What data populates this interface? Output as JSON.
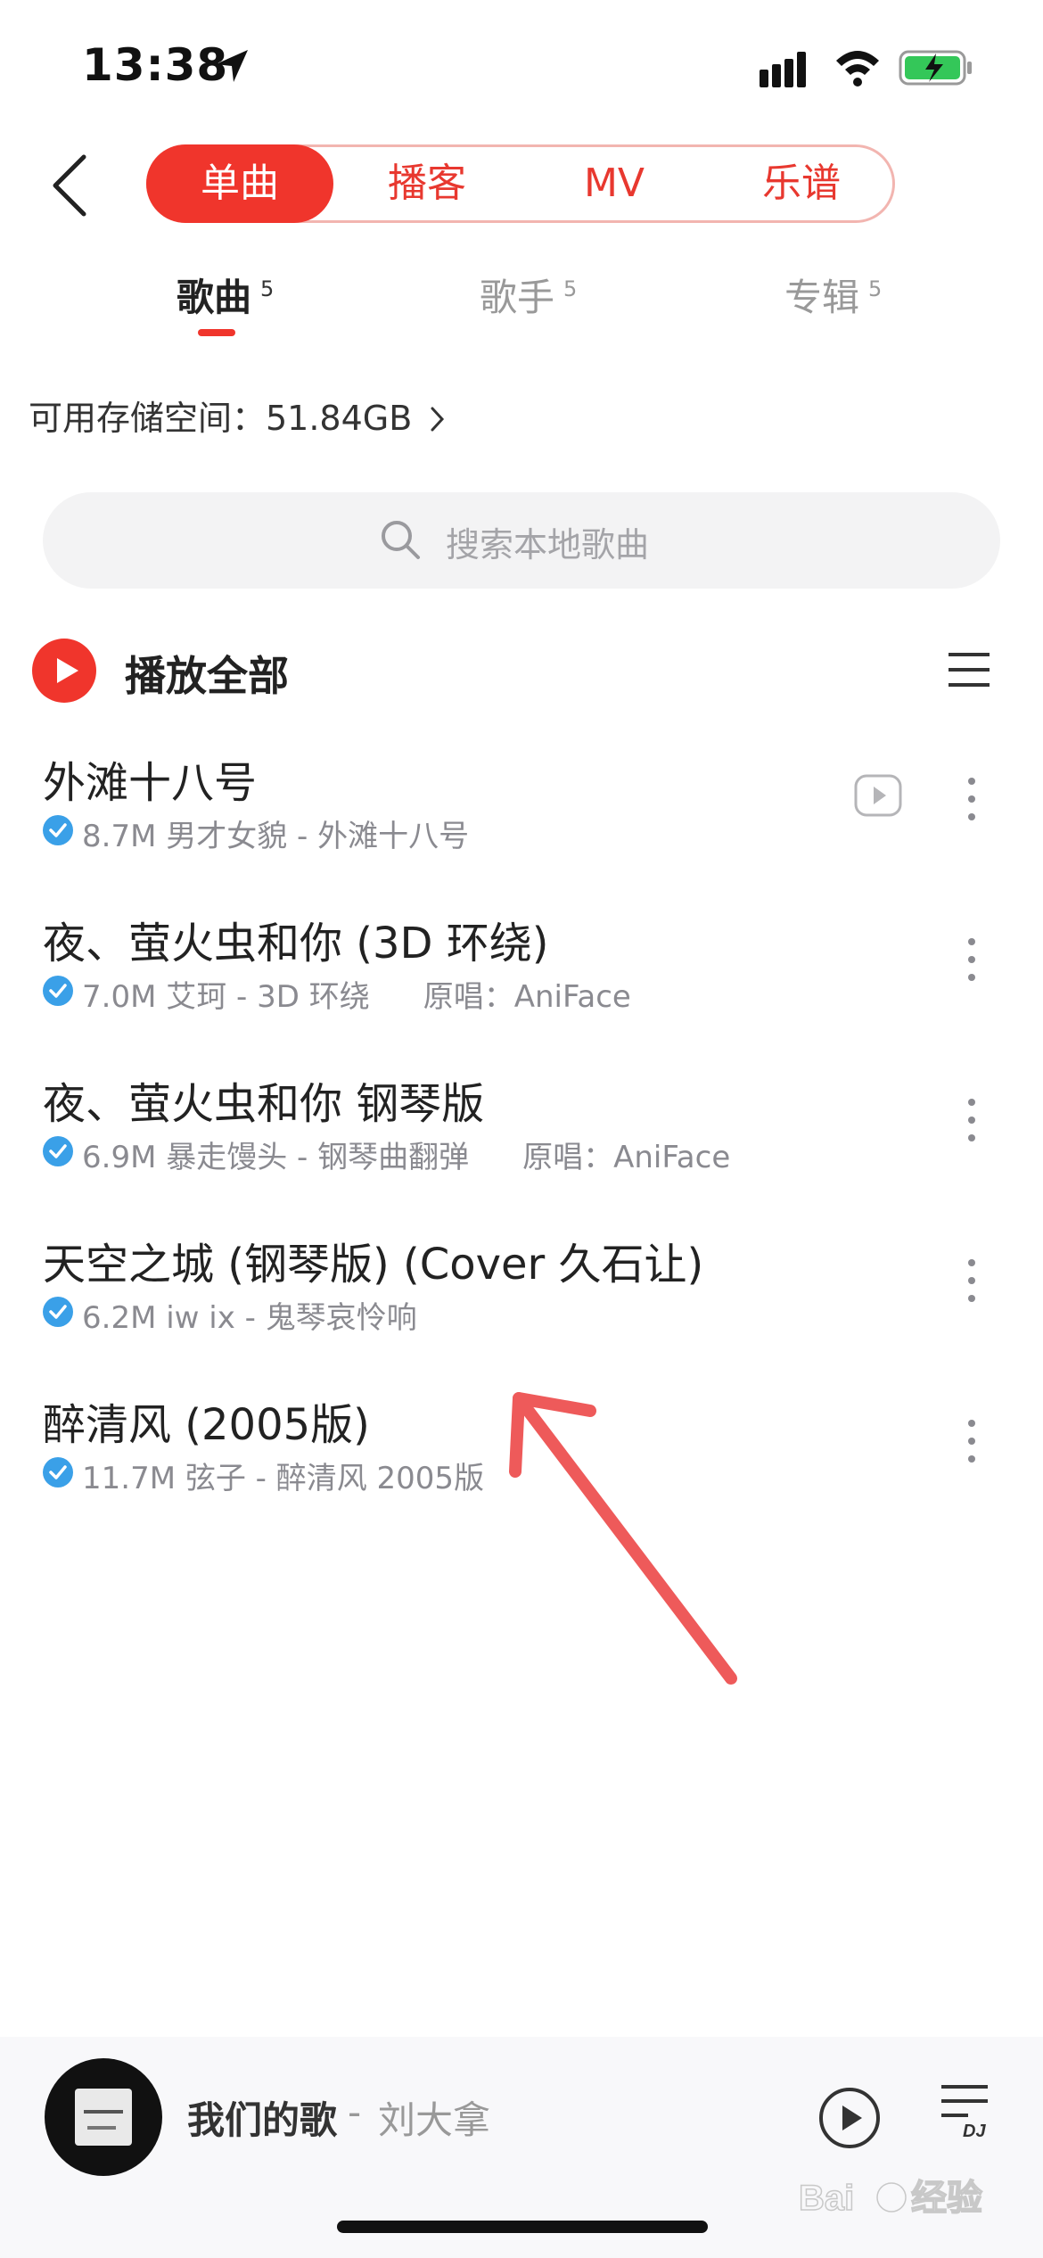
{
  "status_bar": {
    "time": "13:38"
  },
  "nav": {
    "tabs": [
      "单曲",
      "播客",
      "MV",
      "乐谱"
    ],
    "active_tab": "单曲"
  },
  "sub_tabs": [
    {
      "label": "歌曲",
      "count": "5"
    },
    {
      "label": "歌手",
      "count": "5"
    },
    {
      "label": "专辑",
      "count": "5"
    }
  ],
  "storage": {
    "text": "可用存储空间：51.84GB"
  },
  "search": {
    "placeholder": "搜索本地歌曲"
  },
  "play_all": {
    "label": "播放全部"
  },
  "songs": [
    {
      "title": "外滩十八号",
      "meta": "8.7M 男才女貌 - 外滩十八号",
      "original": ""
    },
    {
      "title": "夜、萤火虫和你 (3D 环绕)",
      "meta": "7.0M 艾珂 - 3D 环绕",
      "original": "原唱：AniFace"
    },
    {
      "title": "夜、萤火虫和你 钢琴版",
      "meta": "6.9M 暴走馒头 - 钢琴曲翻弹",
      "original": "原唱：AniFace"
    },
    {
      "title": "天空之城 (钢琴版) (Cover 久石让)",
      "meta": "6.2M iw ix - 鬼琴哀怜响",
      "original": ""
    },
    {
      "title": "醉清风 (2005版)",
      "meta": "11.7M 弦子 - 醉清风 2005版",
      "original": ""
    }
  ],
  "player": {
    "song": "我们的歌",
    "separator": "-",
    "artist": "刘大拿"
  },
  "colors": {
    "accent": "#f0352c",
    "check": "#3aa0e8",
    "arrow": "#ee5a5a"
  },
  "icons": [
    "location-icon",
    "signal-icon",
    "wifi-icon",
    "battery-charging-icon",
    "back-icon",
    "search-icon",
    "play-all-icon",
    "list-menu-icon",
    "verified-check-icon",
    "mv-play-icon",
    "more-vertical-icon",
    "play-icon",
    "playlist-dj-icon"
  ]
}
